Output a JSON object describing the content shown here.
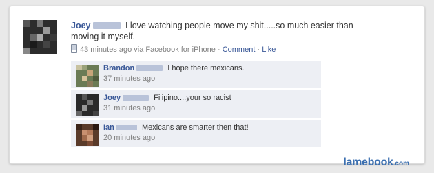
{
  "post": {
    "author": "Joey",
    "text": "I love watching people move my shit.....so much easier than moving it myself.",
    "time": "43 minutes ago via Facebook for iPhone",
    "comment_link": "Comment",
    "like_link": "Like",
    "separator": "·"
  },
  "comments": [
    {
      "author": "Brandon",
      "text": "I hope there mexicans.",
      "time": "37 minutes ago"
    },
    {
      "author": "Joey",
      "text": "Filipino....your so racist",
      "time": "31 minutes ago"
    },
    {
      "author": "Ian",
      "text": "Mexicans are smarter then that!",
      "time": "20 minutes ago"
    }
  ],
  "watermark": {
    "brand": "lamebook",
    "tld": ".com"
  },
  "colors": {
    "link": "#3b5998",
    "comment_bg": "#edeff4",
    "watermark": "#3b6fb0"
  }
}
